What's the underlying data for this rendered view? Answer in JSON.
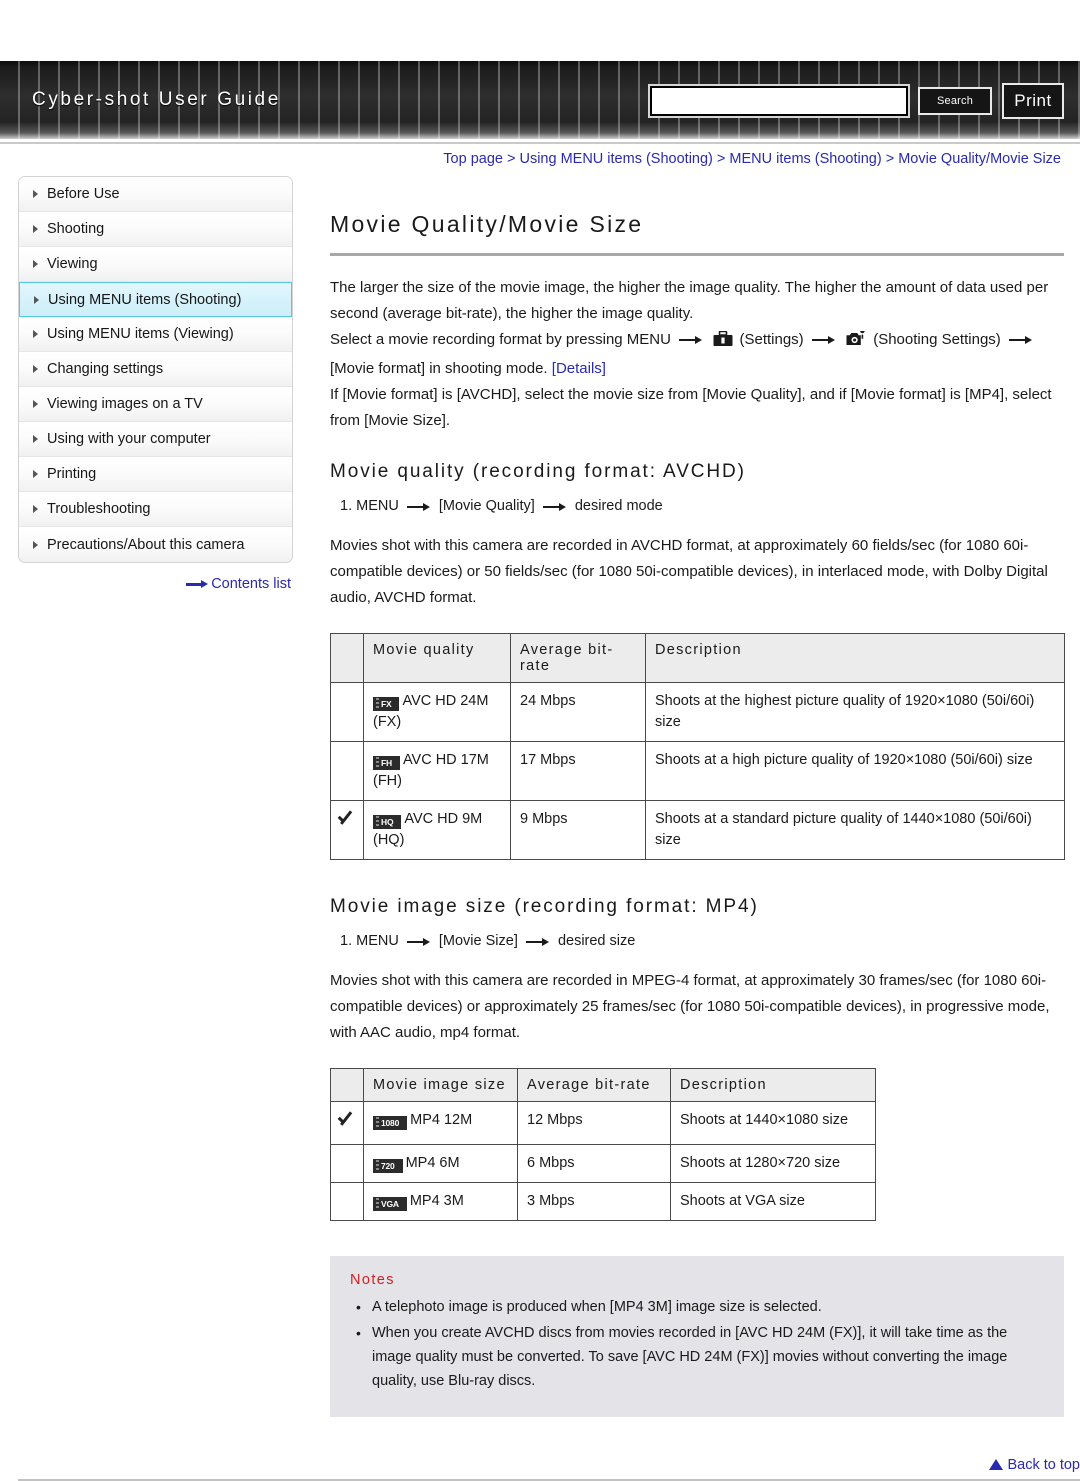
{
  "header": {
    "site_title": "Cyber-shot User Guide",
    "search_value": "",
    "search_placeholder": "",
    "search_label": "Search",
    "print_label": "Print"
  },
  "sidebar": {
    "items": [
      {
        "label": "Before Use",
        "active": false
      },
      {
        "label": "Shooting",
        "active": false
      },
      {
        "label": "Viewing",
        "active": false
      },
      {
        "label": "Using MENU items (Shooting)",
        "active": true
      },
      {
        "label": "Using MENU items (Viewing)",
        "active": false
      },
      {
        "label": "Changing settings",
        "active": false
      },
      {
        "label": "Viewing images on a TV",
        "active": false
      },
      {
        "label": "Using with your computer",
        "active": false
      },
      {
        "label": "Printing",
        "active": false
      },
      {
        "label": "Troubleshooting",
        "active": false
      },
      {
        "label": "Precautions/About this camera",
        "active": false
      }
    ],
    "contents_link": "Contents list"
  },
  "main": {
    "breadcrumb": "Top page > Using MENU items (Shooting) > MENU items (Shooting) > Movie Quality/Movie Size",
    "title": "Movie Quality/Movie Size",
    "intro_p1": "The larger the size of the movie image, the higher the image quality. The higher the amount of data used per second (average bit-rate), the higher the image quality.",
    "intro_p2_a": "Select a movie recording format by pressing MENU",
    "intro_p2_b": "(Settings)",
    "intro_p2_c": "(Shooting Settings)",
    "intro_p2_d": "[Movie format] in shooting mode.",
    "details_link": "[Details]",
    "intro_p3": "If [Movie format] is [AVCHD], select the movie size from [Movie Quality], and if [Movie format] is [MP4], select from [Movie Size].",
    "section_avchd": {
      "heading": "Movie quality (recording format: AVCHD)",
      "step_num": "1.",
      "step_a": "MENU",
      "step_b": "[Movie Quality]",
      "step_c": "desired mode",
      "paragraph": "Movies shot with this camera are recorded in AVCHD format, at approximately 60 fields/sec (for 1080 60i-compatible devices) or 50 fields/sec (for 1080 50i-compatible devices), in interlaced mode, with Dolby Digital audio, AVCHD format.",
      "table": {
        "headers": [
          "",
          "Movie quality",
          "Average bit-rate",
          "Description"
        ],
        "rows": [
          {
            "selected": false,
            "badge": "FX",
            "name": "AVC HD 24M (FX)",
            "bitrate": "24 Mbps",
            "description": "Shoots at the highest picture quality of 1920×1080 (50i/60i) size"
          },
          {
            "selected": false,
            "badge": "FH",
            "name": "AVC HD 17M (FH)",
            "bitrate": "17 Mbps",
            "description": "Shoots at a high picture quality of 1920×1080 (50i/60i) size"
          },
          {
            "selected": true,
            "badge": "HQ",
            "name": "AVC HD 9M (HQ)",
            "bitrate": "9 Mbps",
            "description": "Shoots at a standard picture quality of 1440×1080 (50i/60i) size"
          }
        ]
      }
    },
    "section_mp4": {
      "heading": "Movie image size (recording format: MP4)",
      "step_num": "1.",
      "step_a": "MENU",
      "step_b": "[Movie Size]",
      "step_c": "desired size",
      "paragraph": "Movies shot with this camera are recorded in MPEG-4 format, at approximately 30 frames/sec (for 1080 60i-compatible devices) or approximately 25 frames/sec (for 1080 50i-compatible devices), in progressive mode, with AAC audio, mp4 format.",
      "table": {
        "headers": [
          "",
          "Movie image size",
          "Average bit-rate",
          "Description"
        ],
        "rows": [
          {
            "selected": true,
            "badge": "1080",
            "name": "MP4 12M",
            "bitrate": "12 Mbps",
            "description": "Shoots at 1440×1080 size"
          },
          {
            "selected": false,
            "badge": "720",
            "name": "MP4 6M",
            "bitrate": "6 Mbps",
            "description": "Shoots at 1280×720 size"
          },
          {
            "selected": false,
            "badge": "VGA",
            "name": "MP4 3M",
            "bitrate": "3 Mbps",
            "description": "Shoots at VGA size"
          }
        ]
      }
    },
    "notes": {
      "title": "Notes",
      "items": [
        "A telephoto image is produced when [MP4 3M] image size is selected.",
        "When you create AVCHD discs from movies recorded in [AVC HD 24M (FX)], it will take time as the image quality must be converted. To save [AVC HD 24M (FX)] movies without converting the image quality, use Blu-ray discs."
      ]
    }
  },
  "footer": {
    "back_to_top": "Back to top"
  },
  "colors": {
    "link": "#2a2ab0",
    "accent_active": "#54c8e8",
    "notes_title": "#d71f21",
    "table_header_bg": "#ececec",
    "notes_bg": "#e3e3e8"
  }
}
